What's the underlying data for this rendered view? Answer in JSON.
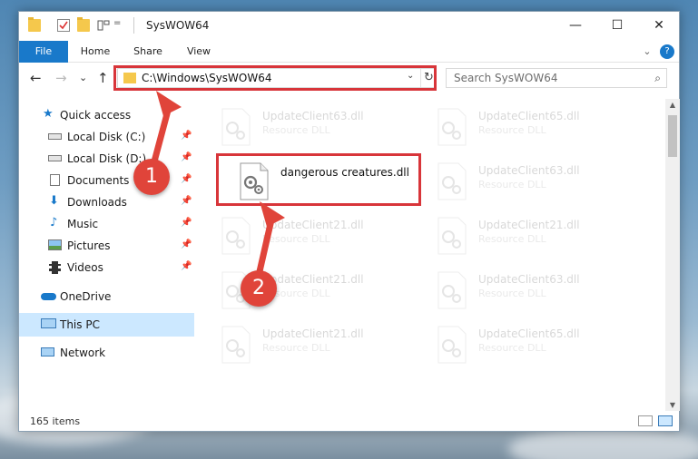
{
  "window": {
    "title": "SysWOW64",
    "controls": {
      "minimize": "—",
      "maximize": "☐",
      "close": "✕"
    },
    "qat": {
      "dropdown": "="
    }
  },
  "ribbon": {
    "tabs": [
      "File",
      "Home",
      "Share",
      "View"
    ],
    "expand_icon": "⌄",
    "help_icon": "?"
  },
  "navigation": {
    "back": "←",
    "forward": "→",
    "recent": "⌄",
    "up": "↑"
  },
  "address": {
    "path": "C:\\Windows\\SysWOW64",
    "dropdown": "⌄",
    "refresh": "↻"
  },
  "search": {
    "placeholder": "Search SysWOW64",
    "icon": "⌕"
  },
  "sidebar": {
    "items": [
      {
        "label": "Quick access",
        "icon": "star-icon",
        "pinned": false
      },
      {
        "label": "Local Disk (C:)",
        "icon": "drive-icon",
        "pinned": true
      },
      {
        "label": "Local Disk (D:)",
        "icon": "drive-icon",
        "pinned": true
      },
      {
        "label": "Documents",
        "icon": "documents-icon",
        "pinned": true
      },
      {
        "label": "Downloads",
        "icon": "downloads-icon",
        "pinned": true
      },
      {
        "label": "Music",
        "icon": "music-icon",
        "pinned": true
      },
      {
        "label": "Pictures",
        "icon": "pictures-icon",
        "pinned": true
      },
      {
        "label": "Videos",
        "icon": "videos-icon",
        "pinned": true
      },
      {
        "label": "OneDrive",
        "icon": "cloud-icon",
        "pinned": false
      },
      {
        "label": "This PC",
        "icon": "computer-icon",
        "pinned": false
      },
      {
        "label": "Network",
        "icon": "network-icon",
        "pinned": false
      }
    ],
    "pin_glyph": "📌"
  },
  "files": [
    {
      "name": "UpdateClient63.dll",
      "type": "Resource DLL",
      "faded": true
    },
    {
      "name": "UpdateClient65.dll",
      "type": "Resource DLL",
      "faded": true
    },
    {
      "name": "dangerous creatures.dll",
      "type": "",
      "faded": false
    },
    {
      "name": "UpdateClient63.dll",
      "type": "Resource DLL",
      "faded": true
    },
    {
      "name": "UpdateClient21.dll",
      "type": "Resource DLL",
      "faded": true
    },
    {
      "name": "UpdateClient21.dll",
      "type": "Resource DLL",
      "faded": true
    },
    {
      "name": "UpdateClient21.dll",
      "type": "Resource DLL",
      "faded": true
    },
    {
      "name": "UpdateClient63.dll",
      "type": "Resource DLL",
      "faded": true
    },
    {
      "name": "UpdateClient21.dll",
      "type": "Resource DLL",
      "faded": true
    },
    {
      "name": "UpdateClient65.dll",
      "type": "Resource DLL",
      "faded": true
    }
  ],
  "status": {
    "items_count": "165 items"
  },
  "annotations": {
    "step1": "1",
    "step2": "2"
  },
  "colors": {
    "accent": "#1979ca",
    "highlight": "#d8353a",
    "badge": "#e0443a",
    "selection": "#cce8ff"
  }
}
